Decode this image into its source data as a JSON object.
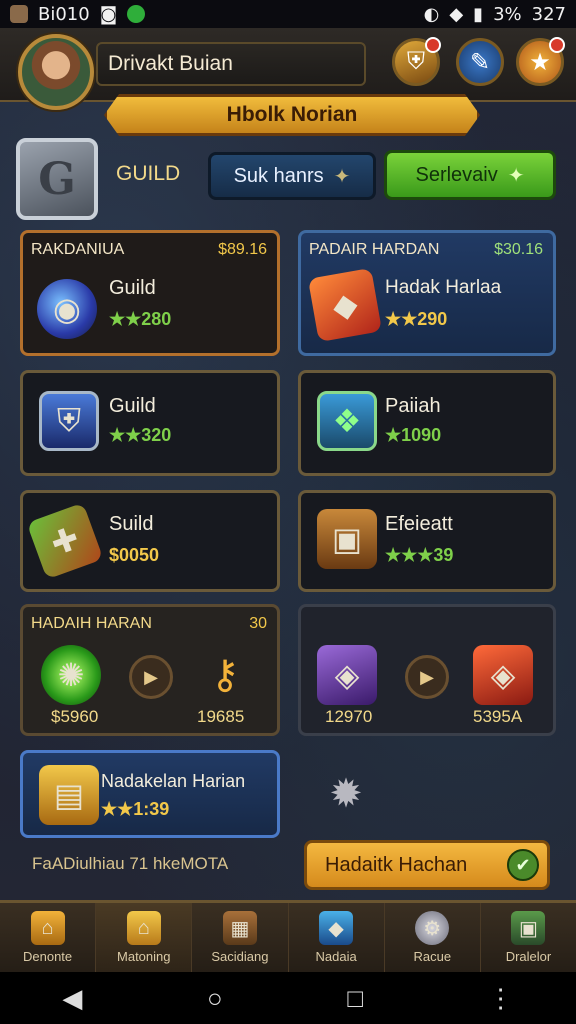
{
  "status_bar": {
    "left_text": "Bi010",
    "right_text": "327",
    "battery_text": "3%"
  },
  "header": {
    "player_name": "Drivakt Buian",
    "title_banner": "Hbolk Norian"
  },
  "guild": {
    "label": "GUILD",
    "search_button": "Suk hanrs",
    "service_button": "Serlevaiv",
    "emblem_letter": "G"
  },
  "cards": {
    "top_left": {
      "header": "RAKDANIUA",
      "cost": "$89.16",
      "name": "Guild",
      "stars": "★★280",
      "icon": "orb-icon"
    },
    "top_right": {
      "header": "PADAIR HARDAN",
      "cost": "$30.16",
      "name": "Hadak Harlaa",
      "stars": "★★290",
      "icon": "crystal-icon"
    },
    "mid_left": {
      "name": "Guild",
      "stars": "★★320",
      "icon": "shield-icon"
    },
    "mid_right": {
      "name": "Paiiah",
      "stars": "★1090",
      "icon": "leaf-shield-icon"
    },
    "lower_left": {
      "name": "Suild",
      "stars": "$0050",
      "icon": "scroll-icon"
    },
    "lower_right": {
      "name": "Efeieatt",
      "stars": "★★★39",
      "icon": "chest-icon"
    }
  },
  "daily_panel": {
    "header": "HADAIH HARAN",
    "count": "30",
    "left_value": "$5960",
    "right_value": "19685",
    "right_panel_left_value": "12970",
    "right_panel_right_value": "5395A"
  },
  "reward_card": {
    "name": "Nadakelan Harian",
    "stars": "★★1:39"
  },
  "footer_note": "FaADiulhiau 71 hkeMOTA",
  "claim_button": "Hadaitk Hachan",
  "nav": [
    {
      "label": "Denonte",
      "icon": "house-icon"
    },
    {
      "label": "Matoning",
      "icon": "home-gold-icon"
    },
    {
      "label": "Sacidiang",
      "icon": "crate-icon"
    },
    {
      "label": "Nadaia",
      "icon": "cube-icon"
    },
    {
      "label": "Racue",
      "icon": "gear-icon"
    },
    {
      "label": "Dralelor",
      "icon": "box-green-icon"
    }
  ],
  "colors": {
    "accent_gold": "#f1bc3c",
    "accent_green": "#7ad23a",
    "accent_blue": "#23466d",
    "panel_dark": "#17191f"
  }
}
